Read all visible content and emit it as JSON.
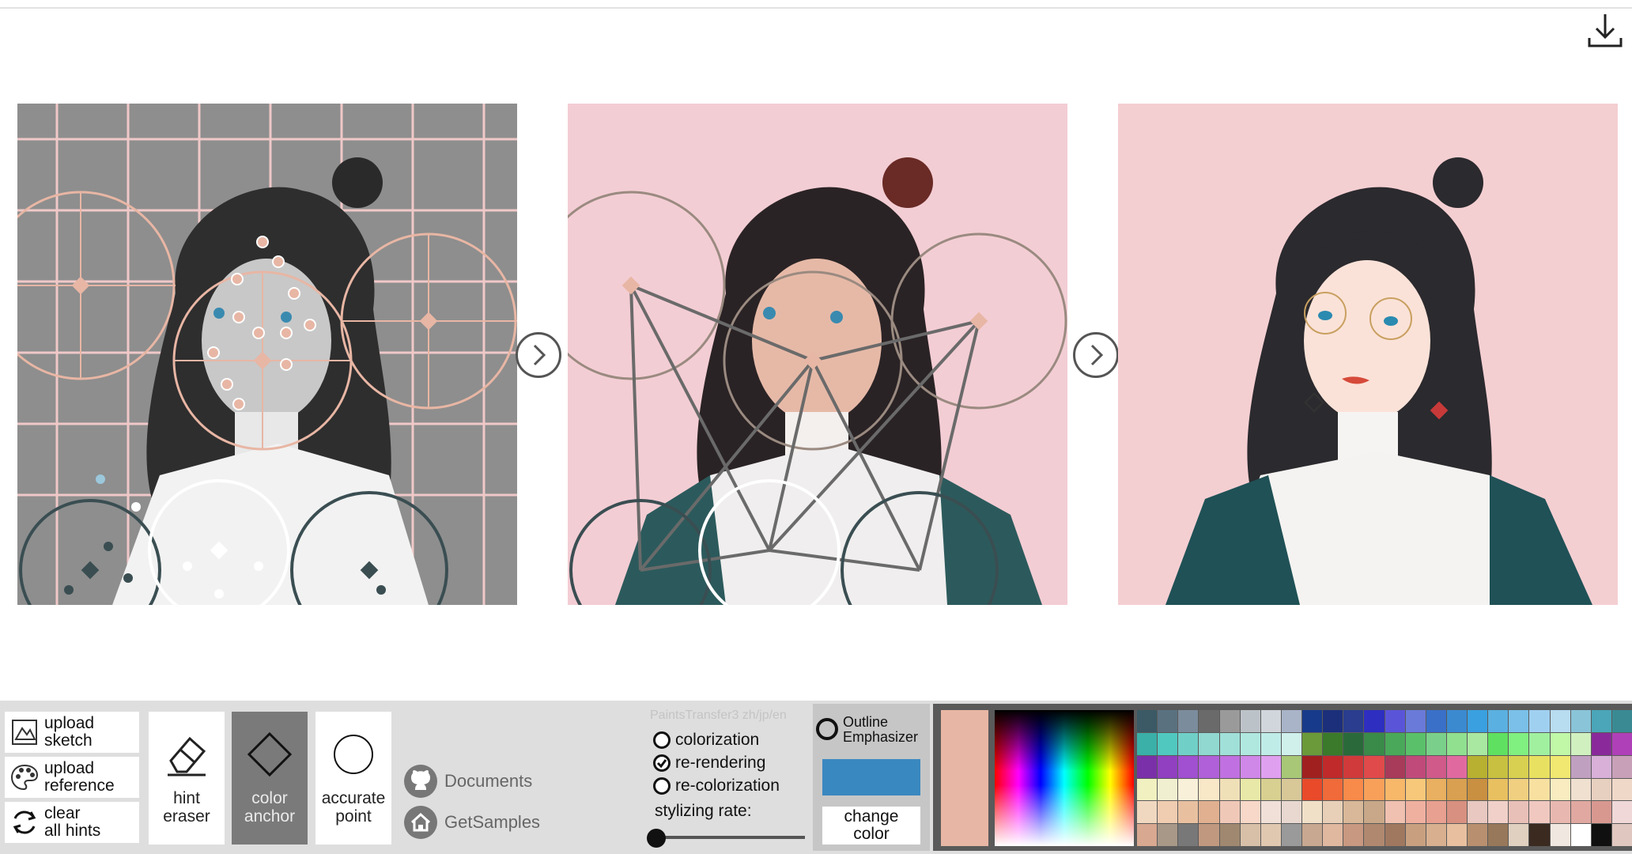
{
  "panels": {
    "sketch": "line art sketch with color hint circles",
    "render": "re-rendered result",
    "final": "final colorized illustration"
  },
  "left_buttons": {
    "upload_sketch": [
      "upload",
      "sketch"
    ],
    "upload_reference": [
      "upload",
      "reference"
    ],
    "clear_hints": [
      "clear",
      "all hints"
    ]
  },
  "tools": {
    "hint_eraser": [
      "hint",
      "eraser"
    ],
    "color_anchor": [
      "color",
      "anchor"
    ],
    "accurate_point": [
      "accurate",
      "point"
    ]
  },
  "links": {
    "documents": "Documents",
    "samples": "GetSamples"
  },
  "mode": {
    "app_title": "PaintsTransfer3 zh/jp/en",
    "options": [
      "colorization",
      "re-rendering",
      "re-colorization"
    ],
    "selected": "re-rendering",
    "rate_label": "stylizing rate:",
    "rate_value": 0.0
  },
  "outline": {
    "label": [
      "Outline",
      "Emphasizer"
    ],
    "current_color": "#3a88c0",
    "change_color_label": [
      "change",
      "color"
    ]
  },
  "palette": {
    "selected_color": "#e8b6a4",
    "colors": [
      "#3b5a66",
      "#5a7180",
      "#7b8c9c",
      "#6a6a6a",
      "#9a9a9a",
      "#bcc3c8",
      "#d0d6dc",
      "#a9b4c8",
      "#173a8a",
      "#1c2f7a",
      "#2a3d8e",
      "#2e2ec0",
      "#5a55d8",
      "#6a7ad8",
      "#3a70c8",
      "#3b8ad0",
      "#3aa0e0",
      "#5ab0e0",
      "#7ac0e8",
      "#a0d0f0",
      "#b8dcf0",
      "#8ac4d8",
      "#4aa6b8",
      "#3a8a94",
      "#3ab0a8",
      "#50c8c0",
      "#70d0c8",
      "#90d8d0",
      "#a0e0d8",
      "#b0e8e0",
      "#c0ece8",
      "#d0f0ec",
      "#6a9a3a",
      "#3a7a2a",
      "#2a6a3a",
      "#3a8a4a",
      "#4aa85a",
      "#5ac06a",
      "#7ad08a",
      "#90e090",
      "#a8e8a0",
      "#60e060",
      "#80f080",
      "#a0f0a0",
      "#c0f8a8",
      "#d0f0c0",
      "#8a2a9a",
      "#b040b8",
      "#7a30a8",
      "#9040c0",
      "#a050d0",
      "#b060d8",
      "#c070e0",
      "#d088e8",
      "#e0a0f0",
      "#a8c878",
      "#a02020",
      "#c02a2a",
      "#d03a3a",
      "#e04a4a",
      "#a83a5a",
      "#c04a7a",
      "#d05a8a",
      "#e06aa0",
      "#b8b030",
      "#c8c040",
      "#d8d050",
      "#e8e060",
      "#f0e870",
      "#c0a0c0",
      "#d8b0d8",
      "#c8a0b8",
      "#f0f0c0",
      "#f0f0d0",
      "#f8f0d8",
      "#f8e8c8",
      "#f0e0b8",
      "#e8e8a8",
      "#d8d090",
      "#d8c898",
      "#e84a2a",
      "#f06a3a",
      "#f88a4a",
      "#f8a05a",
      "#f8b86a",
      "#f8c87a",
      "#e8b060",
      "#d8a050",
      "#c89040",
      "#e8c060",
      "#f0d080",
      "#f8e0a0",
      "#f8ecc0",
      "#f0e0d0",
      "#e8d0c0",
      "#f0d8c8",
      "#f0d8c0",
      "#f0ccb0",
      "#e8c0a0",
      "#e0b090",
      "#f0c8b8",
      "#f8d8c8",
      "#f0e0d8",
      "#e8d8d0",
      "#f0e0c8",
      "#e8d0b8",
      "#d8b898",
      "#c8a888",
      "#f0c0b0",
      "#f0b0a0",
      "#e8a090",
      "#d89080",
      "#e8c8c0",
      "#f0d0c8",
      "#e8c0b8",
      "#f0c8c0",
      "#e8b8b0",
      "#e0a8a0",
      "#d89890",
      "#f0d8d8",
      "#d8a890",
      "#a89888",
      "#787878",
      "#c09880",
      "#a08870",
      "#d8c0a8",
      "#e0c8b0",
      "#9a9a9a",
      "#c8a890",
      "#e0b8a0",
      "#c89880",
      "#b08870",
      "#a07860",
      "#c8a080",
      "#d8b090",
      "#e8c0a0",
      "#b89070",
      "#98785a",
      "#e0d0c0",
      "#3a2a20",
      "#f0e8e0",
      "#ffffff",
      "#101010",
      "#e0c8c0"
    ]
  }
}
